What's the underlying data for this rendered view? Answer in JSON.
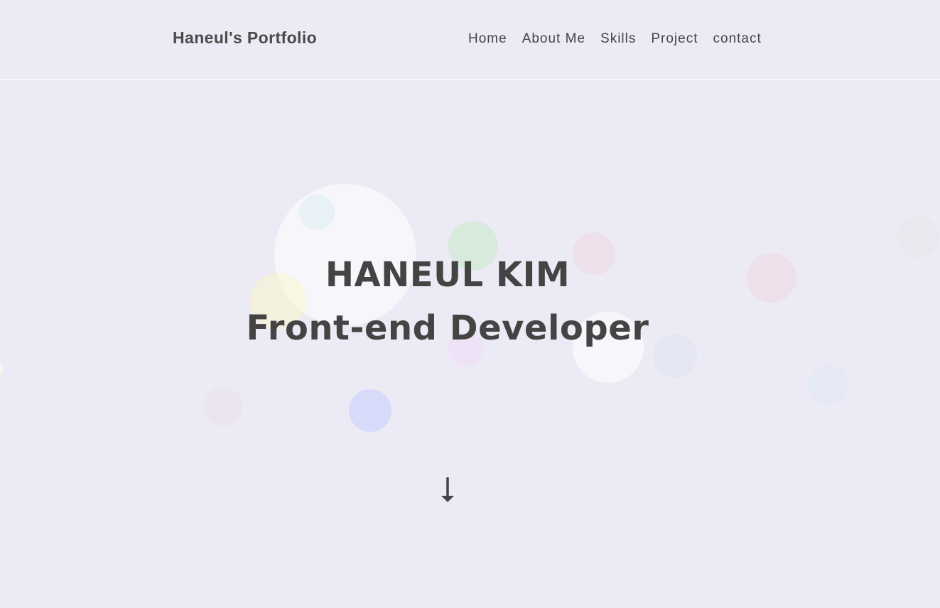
{
  "header": {
    "logo": "Haneul's Portfolio",
    "nav": [
      {
        "label": "Home"
      },
      {
        "label": "About Me"
      },
      {
        "label": "Skills"
      },
      {
        "label": "Project"
      },
      {
        "label": "contact"
      }
    ]
  },
  "hero": {
    "name": "HANEUL KIM",
    "role": "Front-end Developer"
  },
  "colors": {
    "background": "#ecebf5",
    "text": "#444444"
  },
  "icons": {
    "scroll": "arrow-down-icon"
  }
}
